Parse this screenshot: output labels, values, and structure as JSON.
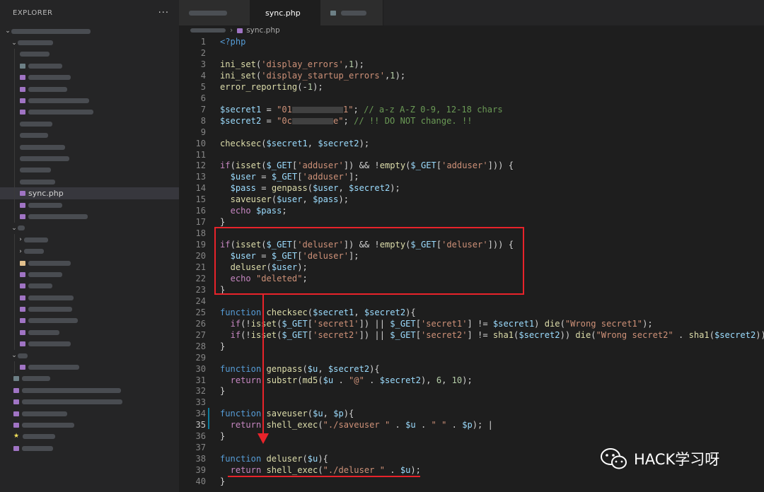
{
  "sidebar": {
    "title": "EXPLORER",
    "more_icon": "ellipsis-icon",
    "active_file": "sync.php"
  },
  "tabs": [
    {
      "label": "",
      "redacted": true,
      "active": false
    },
    {
      "label": "sync.php",
      "active": true,
      "modified": true
    },
    {
      "label": "",
      "redacted": true,
      "active": false
    }
  ],
  "breadcrumb": {
    "file": "sync.php"
  },
  "editor": {
    "current_line": 35,
    "lines": [
      [
        {
          "t": "<?php",
          "c": "kw"
        }
      ],
      [],
      [
        {
          "t": "ini_set",
          "c": "fn"
        },
        {
          "t": "(",
          "c": "pt"
        },
        {
          "t": "'display_errors'",
          "c": "st"
        },
        {
          "t": ",",
          "c": "pt"
        },
        {
          "t": "1",
          "c": "nm"
        },
        {
          "t": ");",
          "c": "pt"
        }
      ],
      [
        {
          "t": "ini_set",
          "c": "fn"
        },
        {
          "t": "(",
          "c": "pt"
        },
        {
          "t": "'display_startup_errors'",
          "c": "st"
        },
        {
          "t": ",",
          "c": "pt"
        },
        {
          "t": "1",
          "c": "nm"
        },
        {
          "t": ");",
          "c": "pt"
        }
      ],
      [
        {
          "t": "error_reporting",
          "c": "fn"
        },
        {
          "t": "(-",
          "c": "pt"
        },
        {
          "t": "1",
          "c": "nm"
        },
        {
          "t": ");",
          "c": "pt"
        }
      ],
      [],
      [
        {
          "t": "$secret1",
          "c": "vr"
        },
        {
          "t": " = ",
          "c": "pt"
        },
        {
          "t": "\"01",
          "c": "st"
        },
        {
          "t": "",
          "c": "redact"
        },
        {
          "t": "1\"",
          "c": "st"
        },
        {
          "t": "; ",
          "c": "pt"
        },
        {
          "t": "// a-z A-Z 0-9, 12-18 chars",
          "c": "cm"
        }
      ],
      [
        {
          "t": "$secret2",
          "c": "vr"
        },
        {
          "t": " = ",
          "c": "pt"
        },
        {
          "t": "\"0c",
          "c": "st"
        },
        {
          "t": "",
          "c": "redact"
        },
        {
          "t": "e\"",
          "c": "st"
        },
        {
          "t": "; ",
          "c": "pt"
        },
        {
          "t": "// !! DO NOT change. !!",
          "c": "cm"
        }
      ],
      [],
      [
        {
          "t": "checksec",
          "c": "fn"
        },
        {
          "t": "(",
          "c": "pt"
        },
        {
          "t": "$secret1",
          "c": "vr"
        },
        {
          "t": ", ",
          "c": "pt"
        },
        {
          "t": "$secret2",
          "c": "vr"
        },
        {
          "t": ");",
          "c": "pt"
        }
      ],
      [],
      [
        {
          "t": "if",
          "c": "ctl"
        },
        {
          "t": "(",
          "c": "pt"
        },
        {
          "t": "isset",
          "c": "fn"
        },
        {
          "t": "(",
          "c": "pt"
        },
        {
          "t": "$_GET",
          "c": "vr"
        },
        {
          "t": "[",
          "c": "pt"
        },
        {
          "t": "'adduser'",
          "c": "st"
        },
        {
          "t": "]) && !",
          "c": "pt"
        },
        {
          "t": "empty",
          "c": "fn"
        },
        {
          "t": "(",
          "c": "pt"
        },
        {
          "t": "$_GET",
          "c": "vr"
        },
        {
          "t": "[",
          "c": "pt"
        },
        {
          "t": "'adduser'",
          "c": "st"
        },
        {
          "t": "])) {",
          "c": "pt"
        }
      ],
      [
        {
          "t": "  ",
          "c": "pt"
        },
        {
          "t": "$user",
          "c": "vr"
        },
        {
          "t": " = ",
          "c": "pt"
        },
        {
          "t": "$_GET",
          "c": "vr"
        },
        {
          "t": "[",
          "c": "pt"
        },
        {
          "t": "'adduser'",
          "c": "st"
        },
        {
          "t": "];",
          "c": "pt"
        }
      ],
      [
        {
          "t": "  ",
          "c": "pt"
        },
        {
          "t": "$pass",
          "c": "vr"
        },
        {
          "t": " = ",
          "c": "pt"
        },
        {
          "t": "genpass",
          "c": "fn"
        },
        {
          "t": "(",
          "c": "pt"
        },
        {
          "t": "$user",
          "c": "vr"
        },
        {
          "t": ", ",
          "c": "pt"
        },
        {
          "t": "$secret2",
          "c": "vr"
        },
        {
          "t": ");",
          "c": "pt"
        }
      ],
      [
        {
          "t": "  ",
          "c": "pt"
        },
        {
          "t": "saveuser",
          "c": "fn"
        },
        {
          "t": "(",
          "c": "pt"
        },
        {
          "t": "$user",
          "c": "vr"
        },
        {
          "t": ", ",
          "c": "pt"
        },
        {
          "t": "$pass",
          "c": "vr"
        },
        {
          "t": ");",
          "c": "pt"
        }
      ],
      [
        {
          "t": "  ",
          "c": "pt"
        },
        {
          "t": "echo",
          "c": "ctl"
        },
        {
          "t": " ",
          "c": "pt"
        },
        {
          "t": "$pass",
          "c": "vr"
        },
        {
          "t": ";",
          "c": "pt"
        }
      ],
      [
        {
          "t": "}",
          "c": "pt"
        }
      ],
      [],
      [
        {
          "t": "if",
          "c": "ctl"
        },
        {
          "t": "(",
          "c": "pt"
        },
        {
          "t": "isset",
          "c": "fn"
        },
        {
          "t": "(",
          "c": "pt"
        },
        {
          "t": "$_GET",
          "c": "vr"
        },
        {
          "t": "[",
          "c": "pt"
        },
        {
          "t": "'deluser'",
          "c": "st"
        },
        {
          "t": "]) && !",
          "c": "pt"
        },
        {
          "t": "empty",
          "c": "fn"
        },
        {
          "t": "(",
          "c": "pt"
        },
        {
          "t": "$_GET",
          "c": "vr"
        },
        {
          "t": "[",
          "c": "pt"
        },
        {
          "t": "'deluser'",
          "c": "st"
        },
        {
          "t": "])) {",
          "c": "pt"
        }
      ],
      [
        {
          "t": "  ",
          "c": "pt"
        },
        {
          "t": "$user",
          "c": "vr"
        },
        {
          "t": " = ",
          "c": "pt"
        },
        {
          "t": "$_GET",
          "c": "vr"
        },
        {
          "t": "[",
          "c": "pt"
        },
        {
          "t": "'deluser'",
          "c": "st"
        },
        {
          "t": "];",
          "c": "pt"
        }
      ],
      [
        {
          "t": "  ",
          "c": "pt"
        },
        {
          "t": "deluser",
          "c": "fn"
        },
        {
          "t": "(",
          "c": "pt"
        },
        {
          "t": "$user",
          "c": "vr"
        },
        {
          "t": ");",
          "c": "pt"
        }
      ],
      [
        {
          "t": "  ",
          "c": "pt"
        },
        {
          "t": "echo",
          "c": "ctl"
        },
        {
          "t": " ",
          "c": "pt"
        },
        {
          "t": "\"deleted\"",
          "c": "st"
        },
        {
          "t": ";",
          "c": "pt"
        }
      ],
      [
        {
          "t": "}",
          "c": "pt"
        }
      ],
      [],
      [
        {
          "t": "function",
          "c": "kw"
        },
        {
          "t": " ",
          "c": "pt"
        },
        {
          "t": "checksec",
          "c": "fn"
        },
        {
          "t": "(",
          "c": "pt"
        },
        {
          "t": "$secret1",
          "c": "vr"
        },
        {
          "t": ", ",
          "c": "pt"
        },
        {
          "t": "$secret2",
          "c": "vr"
        },
        {
          "t": "){",
          "c": "pt"
        }
      ],
      [
        {
          "t": "  ",
          "c": "pt"
        },
        {
          "t": "if",
          "c": "ctl"
        },
        {
          "t": "(!",
          "c": "pt"
        },
        {
          "t": "isset",
          "c": "fn"
        },
        {
          "t": "(",
          "c": "pt"
        },
        {
          "t": "$_GET",
          "c": "vr"
        },
        {
          "t": "[",
          "c": "pt"
        },
        {
          "t": "'secret1'",
          "c": "st"
        },
        {
          "t": "]) || ",
          "c": "pt"
        },
        {
          "t": "$_GET",
          "c": "vr"
        },
        {
          "t": "[",
          "c": "pt"
        },
        {
          "t": "'secret1'",
          "c": "st"
        },
        {
          "t": "] != ",
          "c": "pt"
        },
        {
          "t": "$secret1",
          "c": "vr"
        },
        {
          "t": ") ",
          "c": "pt"
        },
        {
          "t": "die",
          "c": "fn"
        },
        {
          "t": "(",
          "c": "pt"
        },
        {
          "t": "\"Wrong secret1\"",
          "c": "st"
        },
        {
          "t": ");",
          "c": "pt"
        }
      ],
      [
        {
          "t": "  ",
          "c": "pt"
        },
        {
          "t": "if",
          "c": "ctl"
        },
        {
          "t": "(!",
          "c": "pt"
        },
        {
          "t": "isset",
          "c": "fn"
        },
        {
          "t": "(",
          "c": "pt"
        },
        {
          "t": "$_GET",
          "c": "vr"
        },
        {
          "t": "[",
          "c": "pt"
        },
        {
          "t": "'secret2'",
          "c": "st"
        },
        {
          "t": "]) || ",
          "c": "pt"
        },
        {
          "t": "$_GET",
          "c": "vr"
        },
        {
          "t": "[",
          "c": "pt"
        },
        {
          "t": "'secret2'",
          "c": "st"
        },
        {
          "t": "] != ",
          "c": "pt"
        },
        {
          "t": "sha1",
          "c": "fn"
        },
        {
          "t": "(",
          "c": "pt"
        },
        {
          "t": "$secret2",
          "c": "vr"
        },
        {
          "t": ")) ",
          "c": "pt"
        },
        {
          "t": "die",
          "c": "fn"
        },
        {
          "t": "(",
          "c": "pt"
        },
        {
          "t": "\"Wrong secret2\"",
          "c": "st"
        },
        {
          "t": " . ",
          "c": "pt"
        },
        {
          "t": "sha1",
          "c": "fn"
        },
        {
          "t": "(",
          "c": "pt"
        },
        {
          "t": "$secret2",
          "c": "vr"
        },
        {
          "t": "));",
          "c": "pt"
        }
      ],
      [
        {
          "t": "}",
          "c": "pt"
        }
      ],
      [],
      [
        {
          "t": "function",
          "c": "kw"
        },
        {
          "t": " ",
          "c": "pt"
        },
        {
          "t": "genpass",
          "c": "fn"
        },
        {
          "t": "(",
          "c": "pt"
        },
        {
          "t": "$u",
          "c": "vr"
        },
        {
          "t": ", ",
          "c": "pt"
        },
        {
          "t": "$secret2",
          "c": "vr"
        },
        {
          "t": "){",
          "c": "pt"
        }
      ],
      [
        {
          "t": "  ",
          "c": "pt"
        },
        {
          "t": "return",
          "c": "ctl"
        },
        {
          "t": " ",
          "c": "pt"
        },
        {
          "t": "substr",
          "c": "fn"
        },
        {
          "t": "(",
          "c": "pt"
        },
        {
          "t": "md5",
          "c": "fn"
        },
        {
          "t": "(",
          "c": "pt"
        },
        {
          "t": "$u",
          "c": "vr"
        },
        {
          "t": " . ",
          "c": "pt"
        },
        {
          "t": "\"@\"",
          "c": "st"
        },
        {
          "t": " . ",
          "c": "pt"
        },
        {
          "t": "$secret2",
          "c": "vr"
        },
        {
          "t": "), ",
          "c": "pt"
        },
        {
          "t": "6",
          "c": "nm"
        },
        {
          "t": ", ",
          "c": "pt"
        },
        {
          "t": "10",
          "c": "nm"
        },
        {
          "t": ");",
          "c": "pt"
        }
      ],
      [
        {
          "t": "}",
          "c": "pt"
        }
      ],
      [],
      [
        {
          "t": "function",
          "c": "kw"
        },
        {
          "t": " ",
          "c": "pt"
        },
        {
          "t": "saveuser",
          "c": "fn"
        },
        {
          "t": "(",
          "c": "pt"
        },
        {
          "t": "$u",
          "c": "vr"
        },
        {
          "t": ", ",
          "c": "pt"
        },
        {
          "t": "$p",
          "c": "vr"
        },
        {
          "t": "){",
          "c": "pt"
        }
      ],
      [
        {
          "t": "  ",
          "c": "pt"
        },
        {
          "t": "return",
          "c": "ctl"
        },
        {
          "t": " ",
          "c": "pt"
        },
        {
          "t": "shell_exec",
          "c": "fn"
        },
        {
          "t": "(",
          "c": "pt"
        },
        {
          "t": "\"./saveuser \"",
          "c": "st"
        },
        {
          "t": " . ",
          "c": "pt"
        },
        {
          "t": "$u",
          "c": "vr"
        },
        {
          "t": " . ",
          "c": "pt"
        },
        {
          "t": "\" \"",
          "c": "st"
        },
        {
          "t": " . ",
          "c": "pt"
        },
        {
          "t": "$p",
          "c": "vr"
        },
        {
          "t": "); |",
          "c": "pt"
        }
      ],
      [
        {
          "t": "}",
          "c": "pt"
        }
      ],
      [],
      [
        {
          "t": "function",
          "c": "kw"
        },
        {
          "t": " ",
          "c": "pt"
        },
        {
          "t": "deluser",
          "c": "fn"
        },
        {
          "t": "(",
          "c": "pt"
        },
        {
          "t": "$u",
          "c": "vr"
        },
        {
          "t": "){",
          "c": "pt"
        }
      ],
      [
        {
          "t": "  ",
          "c": "pt"
        },
        {
          "t": "return",
          "c": "ctl"
        },
        {
          "t": " ",
          "c": "pt"
        },
        {
          "t": "shell_exec",
          "c": "fn"
        },
        {
          "t": "(",
          "c": "pt"
        },
        {
          "t": "\"./deluser \"",
          "c": "st"
        },
        {
          "t": " . ",
          "c": "pt"
        },
        {
          "t": "$u",
          "c": "vr"
        },
        {
          "t": ");",
          "c": "pt"
        }
      ],
      [
        {
          "t": "}",
          "c": "pt"
        }
      ]
    ]
  },
  "watermark": {
    "text": "HACK学习呀",
    "icon": "wechat-icon"
  },
  "colors": {
    "annotation": "#e8232a",
    "php_icon": "#a074c4"
  }
}
